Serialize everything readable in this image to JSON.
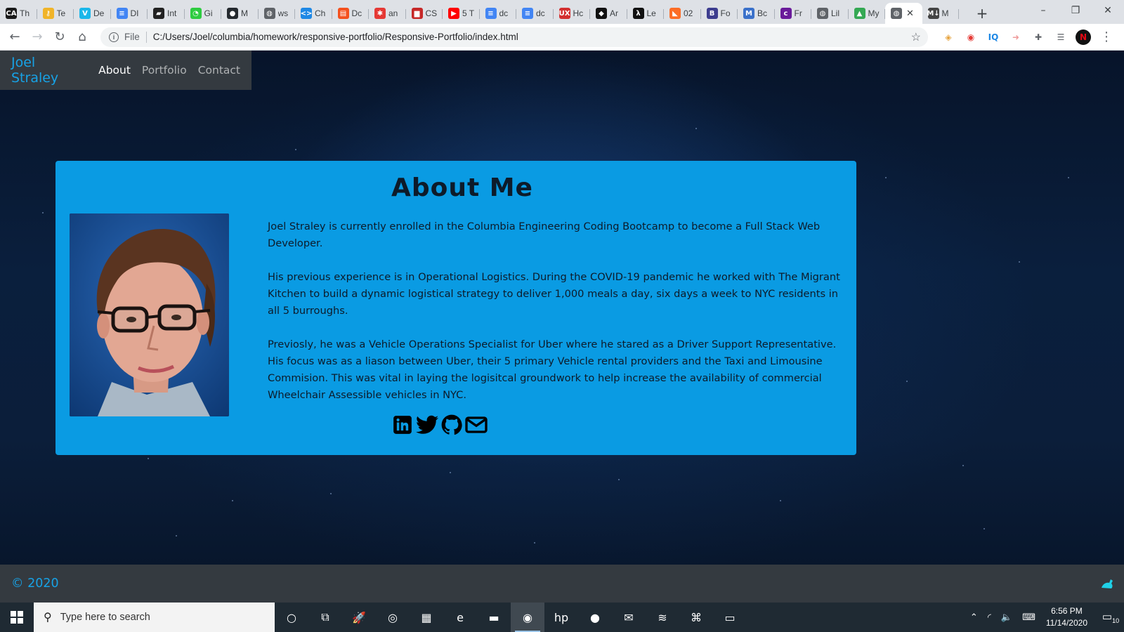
{
  "browser": {
    "tabs": [
      {
        "label": "Th",
        "icon": "ca-icon",
        "bg": "#1a1a1a",
        "glyph": "CA"
      },
      {
        "label": "Te",
        "icon": "key-icon",
        "bg": "#f0b429",
        "glyph": "⚷"
      },
      {
        "label": "De",
        "icon": "vimeo-icon",
        "bg": "#1ab7ea",
        "glyph": "V"
      },
      {
        "label": "DI",
        "icon": "docs-icon",
        "bg": "#4285f4",
        "glyph": "≡"
      },
      {
        "label": "Int",
        "icon": "notebook-icon",
        "bg": "#222",
        "glyph": "▰"
      },
      {
        "label": "Gi",
        "icon": "timer-icon",
        "bg": "#2ecc40",
        "glyph": "◔"
      },
      {
        "label": "M",
        "icon": "github-icon",
        "bg": "#24292e",
        "glyph": "●"
      },
      {
        "label": "ws",
        "icon": "globe-icon",
        "bg": "#5f6368",
        "glyph": "◍"
      },
      {
        "label": "Ch",
        "icon": "code-icon",
        "bg": "#1e88e5",
        "glyph": "<>"
      },
      {
        "label": "Dc",
        "icon": "slides-icon",
        "bg": "#f4511e",
        "glyph": "▤"
      },
      {
        "label": "an",
        "icon": "asterisk-icon",
        "bg": "#e53935",
        "glyph": "✱"
      },
      {
        "label": "CS",
        "icon": "bag-icon",
        "bg": "#c62828",
        "glyph": "▆"
      },
      {
        "label": "5 T",
        "icon": "youtube-icon",
        "bg": "#ff0000",
        "glyph": "▶"
      },
      {
        "label": "dc",
        "icon": "docs-icon",
        "bg": "#4285f4",
        "glyph": "≡"
      },
      {
        "label": "dc",
        "icon": "docs-icon",
        "bg": "#4285f4",
        "glyph": "≡"
      },
      {
        "label": "Hc",
        "icon": "ux-icon",
        "bg": "#d32f2f",
        "glyph": "UX"
      },
      {
        "label": "Ar",
        "icon": "diamond-icon",
        "bg": "#111",
        "glyph": "◆"
      },
      {
        "label": "Le",
        "icon": "lambda-icon",
        "bg": "#111",
        "glyph": "λ"
      },
      {
        "label": "02",
        "icon": "gitlab-icon",
        "bg": "#fc6d26",
        "glyph": "◣"
      },
      {
        "label": "Fo",
        "icon": "bold-b-icon",
        "bg": "#3d3d8f",
        "glyph": "B"
      },
      {
        "label": "Bc",
        "icon": "mdb-icon",
        "bg": "#3b71ca",
        "glyph": "M"
      },
      {
        "label": "Fr",
        "icon": "colorlib-icon",
        "bg": "#6a1b9a",
        "glyph": "c"
      },
      {
        "label": "Lil",
        "icon": "globe-icon",
        "bg": "#5f6368",
        "glyph": "◍"
      },
      {
        "label": "My",
        "icon": "drive-icon",
        "bg": "#34a853",
        "glyph": "▲"
      },
      {
        "label": "",
        "icon": "globe-icon",
        "bg": "#5f6368",
        "glyph": "◍",
        "active": true
      },
      {
        "label": "M",
        "icon": "markdown-icon",
        "bg": "#444",
        "glyph": "M↓"
      }
    ],
    "new_tab": "+",
    "address": {
      "scheme_label": "File",
      "url": "C:/Users/Joel/columbia/homework/responsive-portfolio/Responsive-Portfolio/index.html"
    },
    "extensions": [
      {
        "name": "rss-extension-icon",
        "glyph": "◈",
        "color": "#e6a23c"
      },
      {
        "name": "record-extension-icon",
        "glyph": "◉",
        "color": "#e53935"
      },
      {
        "name": "iq-extension-icon",
        "glyph": "IQ",
        "color": "#1e88e5"
      },
      {
        "name": "arrow-extension-icon",
        "glyph": "➜",
        "color": "#ef9a9a"
      },
      {
        "name": "puzzle-extensions-icon",
        "glyph": "✚",
        "color": "#5f6368"
      },
      {
        "name": "media-control-icon",
        "glyph": "☰",
        "color": "#5f6368"
      }
    ],
    "profile_initial": "N"
  },
  "site": {
    "brand": "Joel Straley",
    "nav": [
      "About",
      "Portfolio",
      "Contact"
    ],
    "about": {
      "title": "About Me",
      "paragraphs": [
        "Joel Straley is currently enrolled in the Columbia Engineering Coding Bootcamp to become a Full Stack Web Developer.",
        "His previous experience is in Operational Logistics. During the COVID-19 pandemic he worked with The Migrant Kitchen to build a dynamic logistical strategy to deliver 1,000 meals a day, six days a week to NYC residents in all 5 burroughs.",
        "Previosly, he was a Vehicle Operations Specialist for Uber where he stared as a Driver Support Representative. His focus was as a liason between Uber, their 5 primary Vehicle rental providers and the Taxi and Limousine Commision. This was vital in laying the logisitcal groundwork to help increase the availability of commercial Wheelchair Assessible vehicles in NYC."
      ],
      "socials": [
        "linkedin-icon",
        "twitter-icon",
        "github-icon",
        "email-icon"
      ]
    },
    "footer": "© 2020",
    "accent": "#17a2e6",
    "card_bg": "#0a9be3"
  },
  "taskbar": {
    "search_placeholder": "Type here to search",
    "apps": [
      {
        "name": "cortana-icon",
        "glyph": "○"
      },
      {
        "name": "task-view-icon",
        "glyph": "⧉"
      },
      {
        "name": "rocket-app-icon",
        "glyph": "🚀"
      },
      {
        "name": "chromium-icon",
        "glyph": "◎"
      },
      {
        "name": "store-icon",
        "glyph": "▦"
      },
      {
        "name": "edge-icon",
        "glyph": "e"
      },
      {
        "name": "file-explorer-icon",
        "glyph": "▬"
      },
      {
        "name": "chrome-icon",
        "glyph": "◉",
        "active": true
      },
      {
        "name": "hp-icon",
        "glyph": "hp"
      },
      {
        "name": "wsl-icon",
        "glyph": "●"
      },
      {
        "name": "mail-icon",
        "glyph": "✉"
      },
      {
        "name": "spotify-icon",
        "glyph": "≋"
      },
      {
        "name": "vscode-icon",
        "glyph": "⌘"
      },
      {
        "name": "terminal-icon",
        "glyph": "▭"
      }
    ],
    "time": "6:56 PM",
    "date": "11/14/2020",
    "notification_count": "10"
  }
}
